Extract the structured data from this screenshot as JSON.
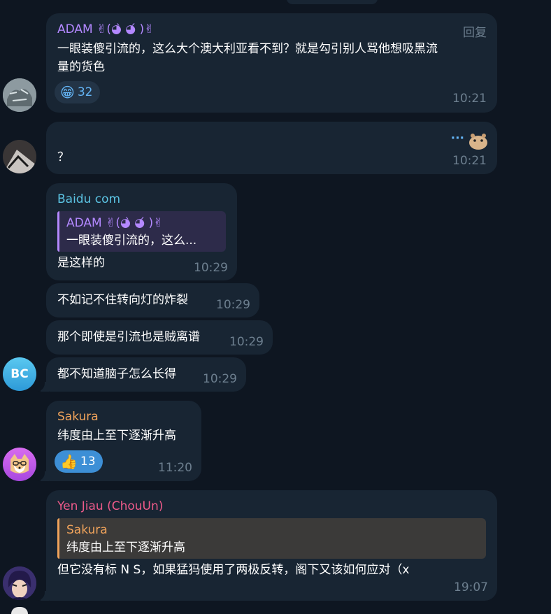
{
  "messages": [
    {
      "sender": "ADAM ✌(◕̀ ◕́ )✌",
      "reply_label": "回复",
      "text_line1": "一眼装傻引流的，这么大个澳大利亚看不到？就是勾引别人骂他想吸黑流",
      "text_line2": "量的货色",
      "reaction": {
        "emoji": "😁",
        "count": "32"
      },
      "time": "10:21"
    },
    {
      "dots": "···",
      "text": "？",
      "time": "10:21"
    },
    {
      "sender": "Baidu com",
      "quote_sender": "ADAM ✌(◕̀ ◕́ )✌",
      "quote_text": "一眼装傻引流的，这么...",
      "text": "是这样的",
      "time": "10:29"
    },
    {
      "text": "不如记不住转向灯的炸裂",
      "time": "10:29"
    },
    {
      "text": "那个即使是引流也是贼离谱",
      "time": "10:29"
    },
    {
      "text": "都不知道脑子怎么长得",
      "time": "10:29",
      "avatar_initials": "BC"
    },
    {
      "sender": "Sakura",
      "text": "纬度由上至下逐渐升高",
      "reaction": {
        "emoji": "👍",
        "count": "13"
      },
      "time": "11:20"
    },
    {
      "sender": "Yen Jiau (ChouUn)",
      "quote_sender": "Sakura",
      "quote_text": "纬度由上至下逐渐升高",
      "text": "但它没有标 N S，如果猛犸使用了两极反转，阁下又该如何应对（x",
      "time": "19:07"
    }
  ],
  "colors": {
    "background": "#0e1621",
    "bubble": "#182533",
    "adam_name": "#b388ff",
    "baidu_name": "#5cc5e5",
    "sakura_name": "#f0a35b",
    "yen_name": "#ee5a8a",
    "time": "#6d7f8f",
    "reaction_blue": "#3d8fd6"
  }
}
